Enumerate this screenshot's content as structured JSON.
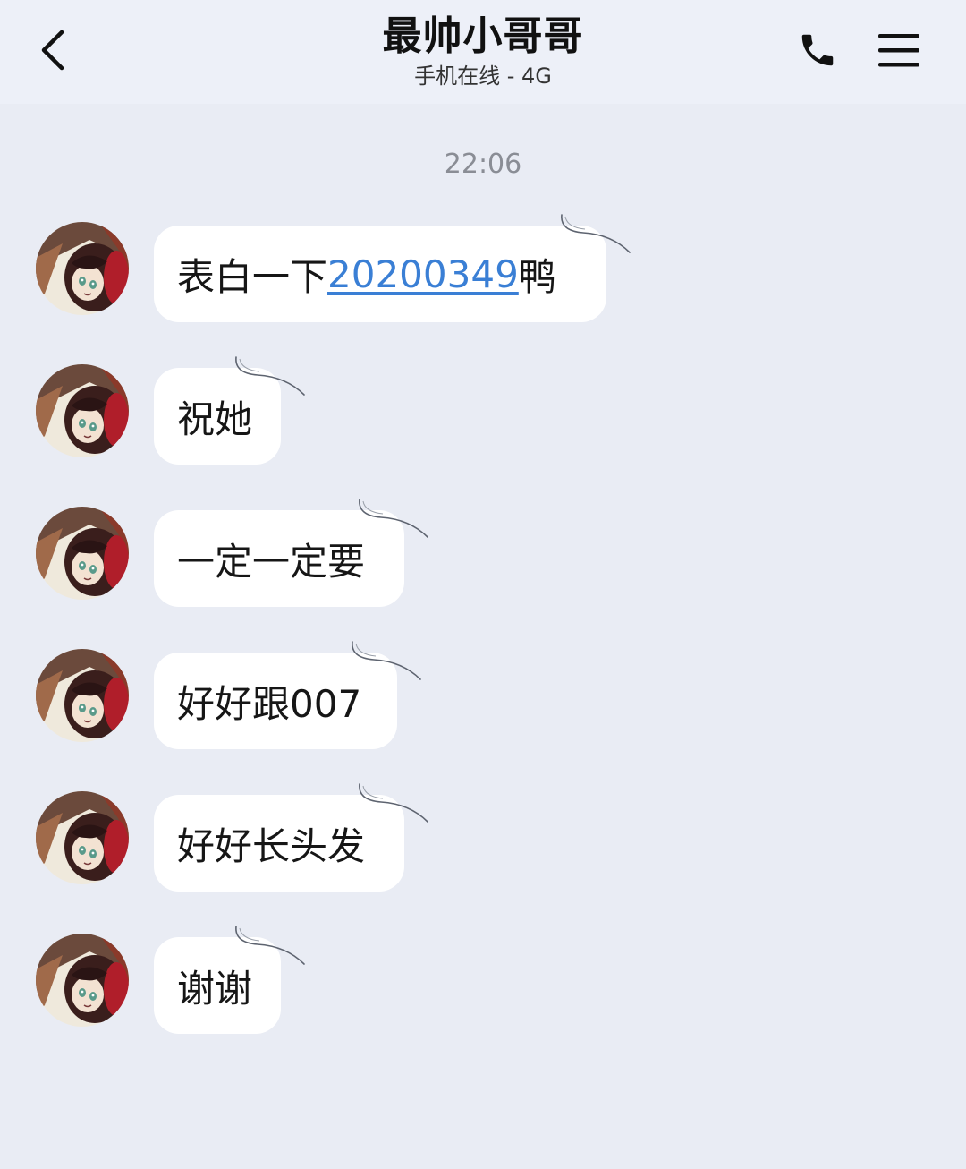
{
  "header": {
    "title": "最帅小哥哥",
    "subtitle": "手机在线 - 4G",
    "back_icon": "chevron-left-icon",
    "call_icon": "phone-icon",
    "menu_icon": "hamburger-menu-icon"
  },
  "colors": {
    "background": "#e9ecf4",
    "header_bg": "#edf0f8",
    "bubble_bg": "#ffffff",
    "link": "#3a7fd5",
    "timestamp": "#8a8d95"
  },
  "chat": {
    "timestamp": "22:06",
    "messages": [
      {
        "sender": "other",
        "avatar": "anime-boy-avatar",
        "prefix": "表白一下",
        "link": "20200349",
        "suffix": "鸭"
      },
      {
        "sender": "other",
        "avatar": "anime-boy-avatar",
        "text": "祝她"
      },
      {
        "sender": "other",
        "avatar": "anime-boy-avatar",
        "text": "一定一定要"
      },
      {
        "sender": "other",
        "avatar": "anime-boy-avatar",
        "text": "好好跟007"
      },
      {
        "sender": "other",
        "avatar": "anime-boy-avatar",
        "text": "好好长头发"
      },
      {
        "sender": "other",
        "avatar": "anime-boy-avatar",
        "text": "谢谢"
      }
    ]
  }
}
